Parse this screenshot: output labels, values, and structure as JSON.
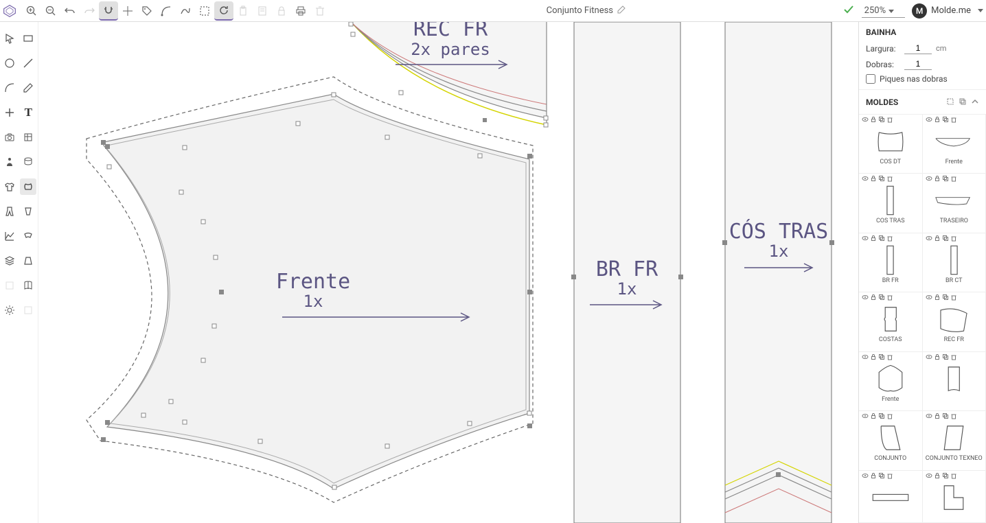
{
  "header": {
    "title": "Conjunto Fitness",
    "zoom": "250%",
    "user_initial": "M",
    "user_name": "Molde.me"
  },
  "right_panel": {
    "section_title": "BAINHA",
    "width_label": "Largura:",
    "width_value": "1",
    "width_unit": "cm",
    "folds_label": "Dobras:",
    "folds_value": "1",
    "notches_label": "Piques nas dobras",
    "moldes_title": "MOLDES"
  },
  "moldes": [
    {
      "label": "CÓS DT"
    },
    {
      "label": "Frente"
    },
    {
      "label": "CÓS TRAS"
    },
    {
      "label": "TRASEIRO"
    },
    {
      "label": "BR FR"
    },
    {
      "label": "BR CT"
    },
    {
      "label": "COSTAS"
    },
    {
      "label": "REC FR"
    },
    {
      "label": "Frente"
    },
    {
      "label": ""
    },
    {
      "label": "CONJUNTO"
    },
    {
      "label": "CONJUNTO TEXNEO"
    },
    {
      "label": ""
    },
    {
      "label": ""
    }
  ],
  "canvas": {
    "pieces": [
      {
        "title": "REC FR",
        "sub": "2x pares"
      },
      {
        "title": "Frente",
        "sub": "1x"
      },
      {
        "title": "BR FR",
        "sub": "1x"
      },
      {
        "title": "CÓS TRAS",
        "sub": "1x"
      }
    ]
  }
}
